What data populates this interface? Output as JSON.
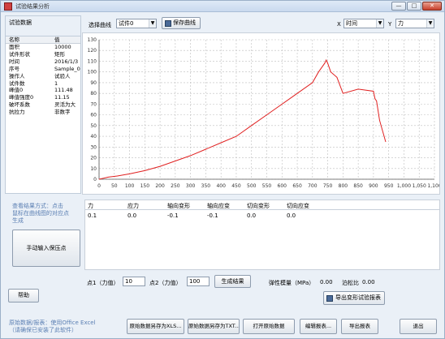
{
  "window": {
    "title": "试验结果分析",
    "min": "—",
    "max": "□",
    "close": "✕"
  },
  "left": {
    "title": "试验数据",
    "head": {
      "name": "名称",
      "value": "值"
    },
    "rows": [
      {
        "k": "面积",
        "v": "10000"
      },
      {
        "k": "试件形状",
        "v": "矩形"
      },
      {
        "k": "时间",
        "v": "2016/1/3"
      },
      {
        "k": "序号",
        "v": "Sample_0"
      },
      {
        "k": "操作人",
        "v": "试验人"
      },
      {
        "k": "试件数",
        "v": "1"
      },
      {
        "k": "峰值0",
        "v": "111.48"
      },
      {
        "k": "峰值强度0",
        "v": "11.15"
      },
      {
        "k": "破坏系数",
        "v": "灵活为大"
      },
      {
        "k": "抗拉力",
        "v": "非数字"
      }
    ]
  },
  "toolbar": {
    "select_label": "选择曲线",
    "select_value": "试件0",
    "save_curve": "保存曲线",
    "x_label": "X",
    "x_value": "时间",
    "y_label": "Y",
    "y_value": "力"
  },
  "chart_data": {
    "type": "line",
    "x_ticks": [
      "0",
      "50",
      "100",
      "150",
      "200",
      "250",
      "300",
      "350",
      "400",
      "450",
      "500",
      "550",
      "600",
      "650",
      "700",
      "750",
      "800",
      "850",
      "900",
      "950",
      "1,000",
      "1,050",
      "1,100"
    ],
    "y_ticks": [
      "0",
      "10",
      "20",
      "30",
      "40",
      "50",
      "60",
      "70",
      "80",
      "90",
      "100",
      "110",
      "120",
      "130"
    ],
    "xlim": [
      0,
      1100
    ],
    "ylim": [
      0,
      130
    ],
    "color": "#e02020",
    "x": [
      0,
      30,
      60,
      100,
      150,
      200,
      250,
      300,
      350,
      400,
      450,
      500,
      550,
      600,
      650,
      700,
      720,
      740,
      745,
      750,
      760,
      780,
      800,
      850,
      900,
      905,
      910,
      920,
      940
    ],
    "y": [
      0,
      2,
      3,
      5,
      8,
      12,
      17,
      22,
      28,
      34,
      40,
      50,
      60,
      70,
      80,
      90,
      100,
      108,
      111,
      108,
      100,
      95,
      80,
      84,
      82,
      75,
      73,
      55,
      35
    ]
  },
  "notes": {
    "line1": "查看结果方式：点击",
    "line2": "鼠标在曲线图的对应点",
    "line3": "生成"
  },
  "manual_button": "手动输入保压点",
  "table": {
    "headers": [
      "力",
      "应力",
      "轴向变形",
      "轴向应变",
      "切向变形",
      "切向应变"
    ],
    "rows": [
      [
        "0.1",
        "0.0",
        "-0.1",
        "-0.1",
        "0.0",
        "0.0"
      ]
    ]
  },
  "points": {
    "p1_label": "点1（力值）",
    "p1_value": "10",
    "p2_label": "点2（力值）",
    "p2_value": "100",
    "generate": "生成结果",
    "modulus_label": "弹性模量（MPa）",
    "modulus_value": "0.00",
    "poisson_label": "泊松比",
    "poisson_value": "0.00"
  },
  "export_report": "导出变形试验报表",
  "help": "帮助",
  "footer_note": {
    "line1": "原始数据/报表：使用Office Excel",
    "line2": "（请确保已安装了此软件）"
  },
  "bottom_buttons": [
    "原始数据另存为XLS...",
    "原始数据另存为TXT...",
    "打开原始数据",
    "编辑报表...",
    "导出报表",
    "退出"
  ]
}
